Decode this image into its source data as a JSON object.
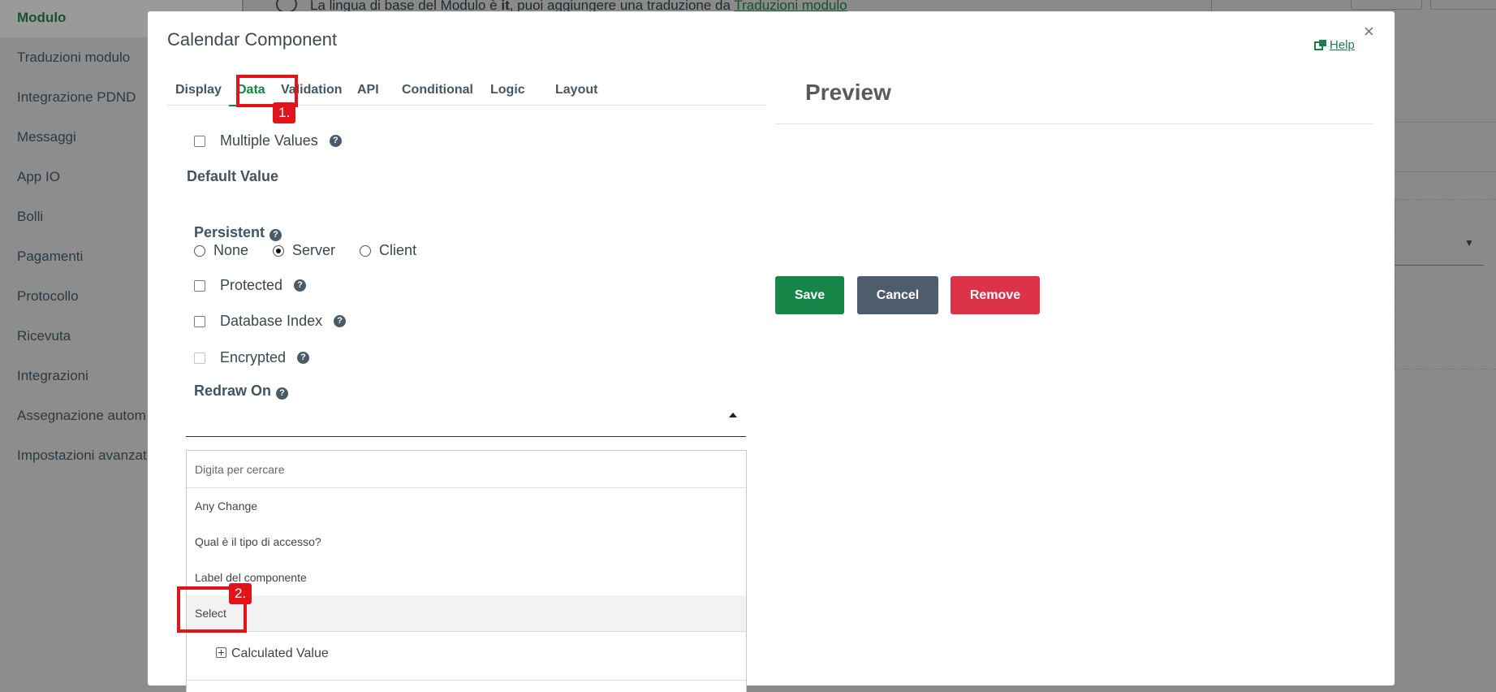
{
  "sidebar": {
    "items": [
      {
        "label": "Modulo",
        "active": true
      },
      {
        "label": "Traduzioni modulo"
      },
      {
        "label": "Integrazione PDND"
      },
      {
        "label": "Messaggi"
      },
      {
        "label": "App IO"
      },
      {
        "label": "Bolli"
      },
      {
        "label": "Pagamenti"
      },
      {
        "label": "Protocollo"
      },
      {
        "label": "Ricevuta"
      },
      {
        "label": "Integrazioni"
      },
      {
        "label": "Assegnazione autom"
      },
      {
        "label": "Impostazioni avanzat"
      }
    ]
  },
  "background": {
    "banner_text_pre": "La lingua di base del Modulo è ",
    "banner_text_bold": "it",
    "banner_text_mid": ", puoi aggiungere una traduzione da ",
    "banner_link": "Traduzioni modulo"
  },
  "modal": {
    "title": "Calendar Component",
    "close_label": "×",
    "help_label": "Help",
    "tabs": [
      "Display",
      "Data",
      "Validation",
      "API",
      "Conditional",
      "Logic",
      "Layout"
    ],
    "active_tab": "Data",
    "annotations": [
      "1.",
      "2."
    ],
    "form": {
      "multiple_values": "Multiple Values",
      "default_value": "Default Value",
      "persistent": "Persistent",
      "persistent_options": [
        "None",
        "Server",
        "Client"
      ],
      "persistent_selected": "Server",
      "protected": "Protected",
      "database_index": "Database Index",
      "encrypted": "Encrypted",
      "redraw_on": "Redraw On",
      "dropdown": {
        "search_placeholder": "Digita per cercare",
        "options": [
          "Any Change",
          "Qual è il tipo di accesso?",
          "Label del componente",
          "Select"
        ],
        "highlighted": "Select"
      },
      "calculated_value": "Calculated Value"
    },
    "preview": {
      "title": "Preview",
      "save_label": "Save",
      "cancel_label": "Cancel",
      "remove_label": "Remove"
    }
  },
  "colors": {
    "accent": "#1a7f4b",
    "save": "#158548",
    "cancel": "#4e5d6c",
    "remove": "#dc3349",
    "annotation": "#e0141a"
  }
}
